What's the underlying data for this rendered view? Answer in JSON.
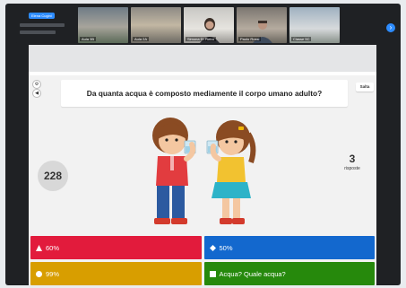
{
  "participants": {
    "first_chip_label": "Elena Cugini",
    "tiles": [
      {
        "label": "Aula 3B"
      },
      {
        "label": "Aula 2A"
      },
      {
        "label": "Simona Di Pietro"
      },
      {
        "label": "Paolo Rossi"
      },
      {
        "label": "Classe 5C"
      }
    ]
  },
  "quiz": {
    "question": "Da quanta acqua è composto mediamente il corpo umano adulto?",
    "skip_label": "Salta",
    "timer": "228",
    "answers_count": "3",
    "answers_word": "risposte",
    "answers": [
      {
        "label": "60%",
        "shape": "triangle-icon",
        "color": "#e21b3c"
      },
      {
        "label": "50%",
        "shape": "diamond-icon",
        "color": "#1368ce"
      },
      {
        "label": "99%",
        "shape": "circle-icon",
        "color": "#d89e00"
      },
      {
        "label": "Acqua? Quale acqua?",
        "shape": "square-icon",
        "color": "#26890c"
      }
    ]
  },
  "colors": {
    "accent": "#2d8cff"
  }
}
